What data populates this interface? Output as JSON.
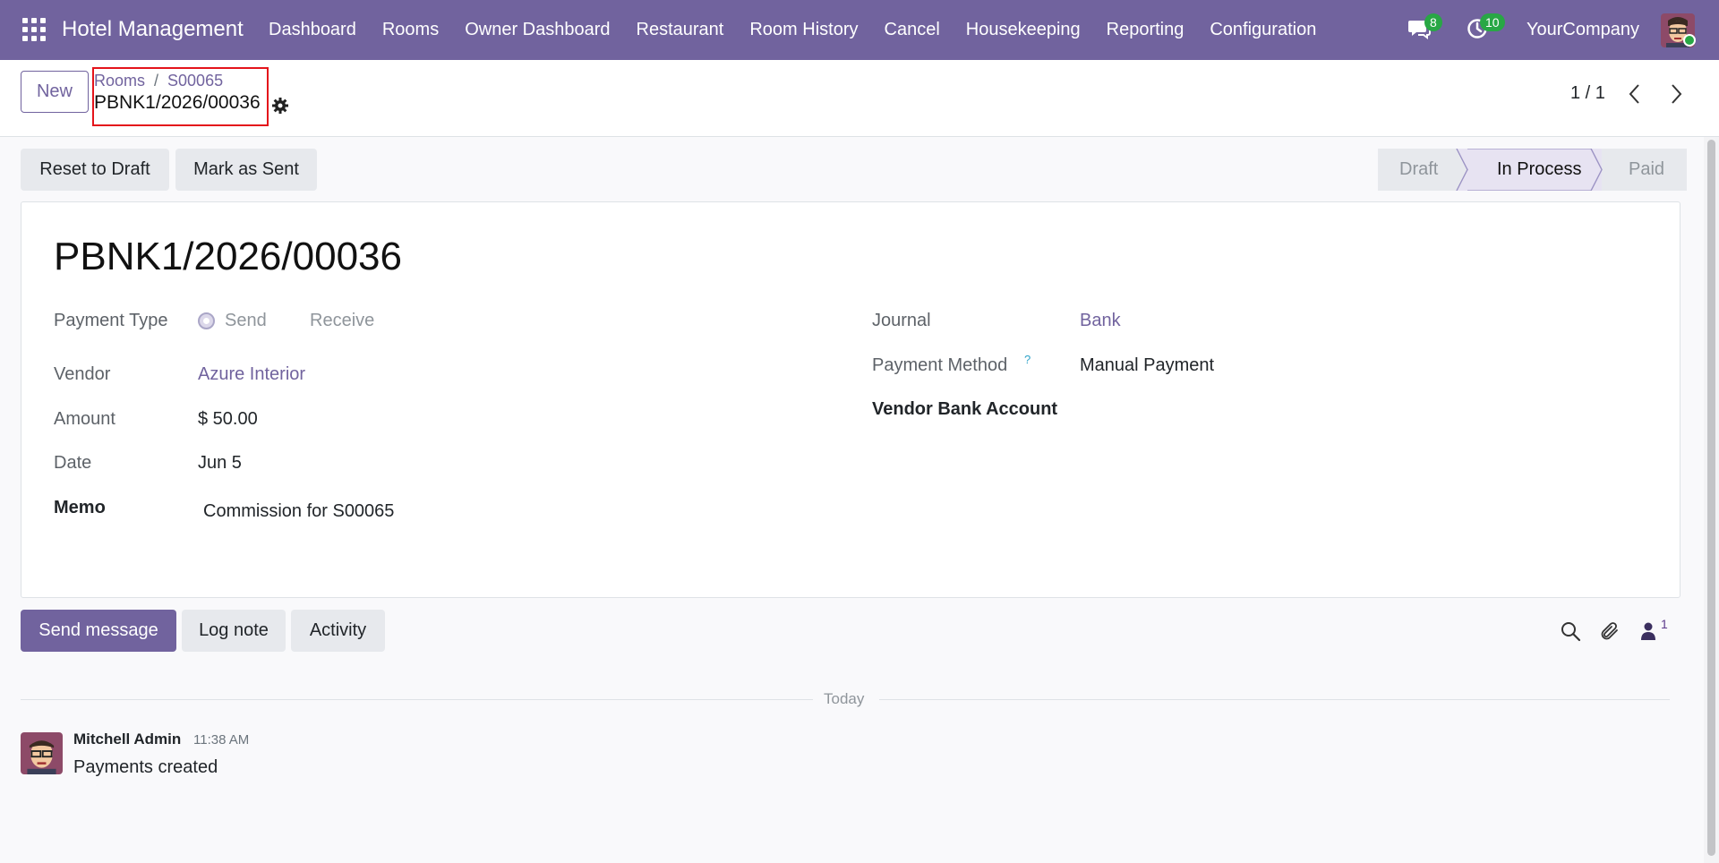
{
  "navbar": {
    "brand": "Hotel Management",
    "menu": [
      "Dashboard",
      "Rooms",
      "Owner Dashboard",
      "Restaurant",
      "Room History",
      "Cancel",
      "Housekeeping",
      "Reporting",
      "Configuration"
    ],
    "messages_count": "8",
    "activities_count": "10",
    "company": "YourCompany",
    "background": "#71639e"
  },
  "control": {
    "new_label": "New",
    "breadcrumb": [
      "Rooms",
      "S00065"
    ],
    "record_name": "PBNK1/2026/00036",
    "pager": "1 / 1"
  },
  "actions": {
    "reset_label": "Reset to Draft",
    "mark_sent_label": "Mark as Sent"
  },
  "status": {
    "stages": [
      "Draft",
      "In Process",
      "Paid"
    ],
    "current": "In Process"
  },
  "form": {
    "title": "PBNK1/2026/00036",
    "payment_type_label": "Payment Type",
    "payment_type_options": [
      "Send",
      "Receive"
    ],
    "payment_type_selected": "Send",
    "vendor_label": "Vendor",
    "vendor": "Azure Interior",
    "amount_label": "Amount",
    "amount": "$ 50.00",
    "date_label": "Date",
    "date": "Jun 5",
    "memo_label": "Memo",
    "memo": "Commission for S00065",
    "journal_label": "Journal",
    "journal": "Bank",
    "payment_method_label": "Payment Method",
    "payment_method_help": "?",
    "payment_method": "Manual Payment",
    "vendor_bank_label": "Vendor Bank Account"
  },
  "chatter": {
    "send_label": "Send message",
    "log_label": "Log note",
    "activity_label": "Activity",
    "followers_count": "1",
    "date_separator": "Today",
    "messages": [
      {
        "author": "Mitchell Admin",
        "time": "11:38 AM",
        "body": "Payments created"
      }
    ]
  }
}
